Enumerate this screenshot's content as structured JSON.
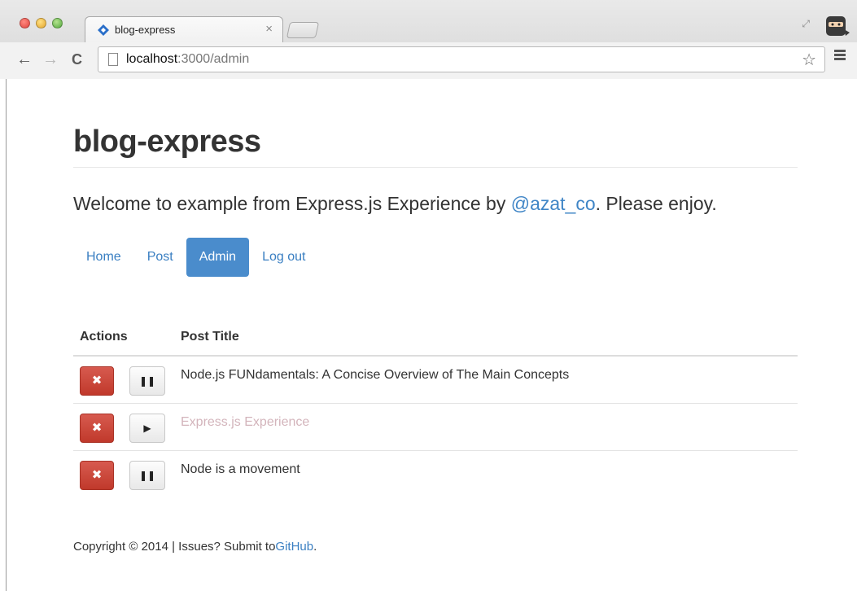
{
  "browser": {
    "tab_title": "blog-express",
    "tab_close": "×",
    "url_host": "localhost",
    "url_rest": ":3000/admin",
    "back_glyph": "←",
    "forward_glyph": "→",
    "reload_glyph": "C",
    "star_glyph": "☆",
    "resize_glyph": "⤢"
  },
  "site": {
    "title": "blog-express",
    "lead_prefix": "Welcome to example from Express.js Experience by ",
    "lead_link": "@azat_co",
    "lead_suffix": ". Please enjoy."
  },
  "nav": {
    "items": [
      {
        "label": "Home",
        "active": false
      },
      {
        "label": "Post",
        "active": false
      },
      {
        "label": "Admin",
        "active": true
      },
      {
        "label": "Log out",
        "active": false
      }
    ]
  },
  "table": {
    "headers": {
      "actions": "Actions",
      "title": "Post Title"
    },
    "rows": [
      {
        "title": "Node.js FUNdamentals: A Concise Overview of The Main Concepts",
        "published": true,
        "toggle_glyph": "❚❚",
        "delete_glyph": "✖"
      },
      {
        "title": "Express.js Experience",
        "published": false,
        "toggle_glyph": "▶",
        "delete_glyph": "✖"
      },
      {
        "title": "Node is a movement",
        "published": true,
        "toggle_glyph": "❚❚",
        "delete_glyph": "✖"
      }
    ]
  },
  "footer": {
    "text": "Copyright © 2014 | Issues? Submit to",
    "link": "GitHub",
    "suffix": "."
  },
  "colors": {
    "accent": "#4a8ccc",
    "link": "#3a7fc2",
    "danger": "#c0392b",
    "unpublished_text": "#d3b4bb"
  }
}
